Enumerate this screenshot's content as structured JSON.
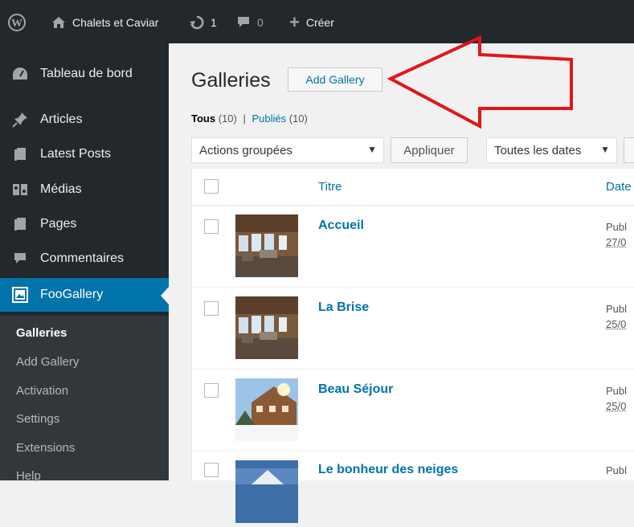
{
  "adminbar": {
    "site_name": "Chalets et Caviar",
    "updates_count": "1",
    "comments_count": "0",
    "new_label": "Créer"
  },
  "sidebar": {
    "items": [
      {
        "label": "Tableau de bord",
        "icon": "dashboard-icon"
      },
      {
        "label": "Articles",
        "icon": "pushpin-icon"
      },
      {
        "label": "Latest Posts",
        "icon": "posts-icon"
      },
      {
        "label": "Médias",
        "icon": "media-icon"
      },
      {
        "label": "Pages",
        "icon": "pages-icon"
      },
      {
        "label": "Commentaires",
        "icon": "comments-icon"
      },
      {
        "label": "FooGallery",
        "icon": "gallery-icon",
        "active": true
      }
    ],
    "submenu": [
      "Galleries",
      "Add Gallery",
      "Activation",
      "Settings",
      "Extensions",
      "Help"
    ],
    "submenu_current": "Galleries"
  },
  "main": {
    "title": "Galleries",
    "add_button": "Add Gallery",
    "filters": {
      "all_label": "Tous",
      "all_count": "(10)",
      "separator": "|",
      "published_label": "Publiés",
      "published_count": "(10)"
    },
    "bulk_actions": "Actions groupées",
    "apply_button": "Appliquer",
    "dates_filter": "Toutes les dates",
    "columns": {
      "title": "Titre",
      "date": "Date"
    },
    "rows": [
      {
        "title": "Accueil",
        "status": "Publ",
        "date": "27/0"
      },
      {
        "title": "La Brise",
        "status": "Publ",
        "date": "25/0"
      },
      {
        "title": "Beau Séjour",
        "status": "Publ",
        "date": "25/0"
      },
      {
        "title": "Le bonheur des neiges",
        "status": "Publ",
        "date": ""
      }
    ]
  },
  "colors": {
    "adminbar_bg": "#23282d",
    "sidebar_bg": "#23282d",
    "active_menu": "#0073aa",
    "link": "#0073aa",
    "annotation_arrow": "#e3151a"
  }
}
